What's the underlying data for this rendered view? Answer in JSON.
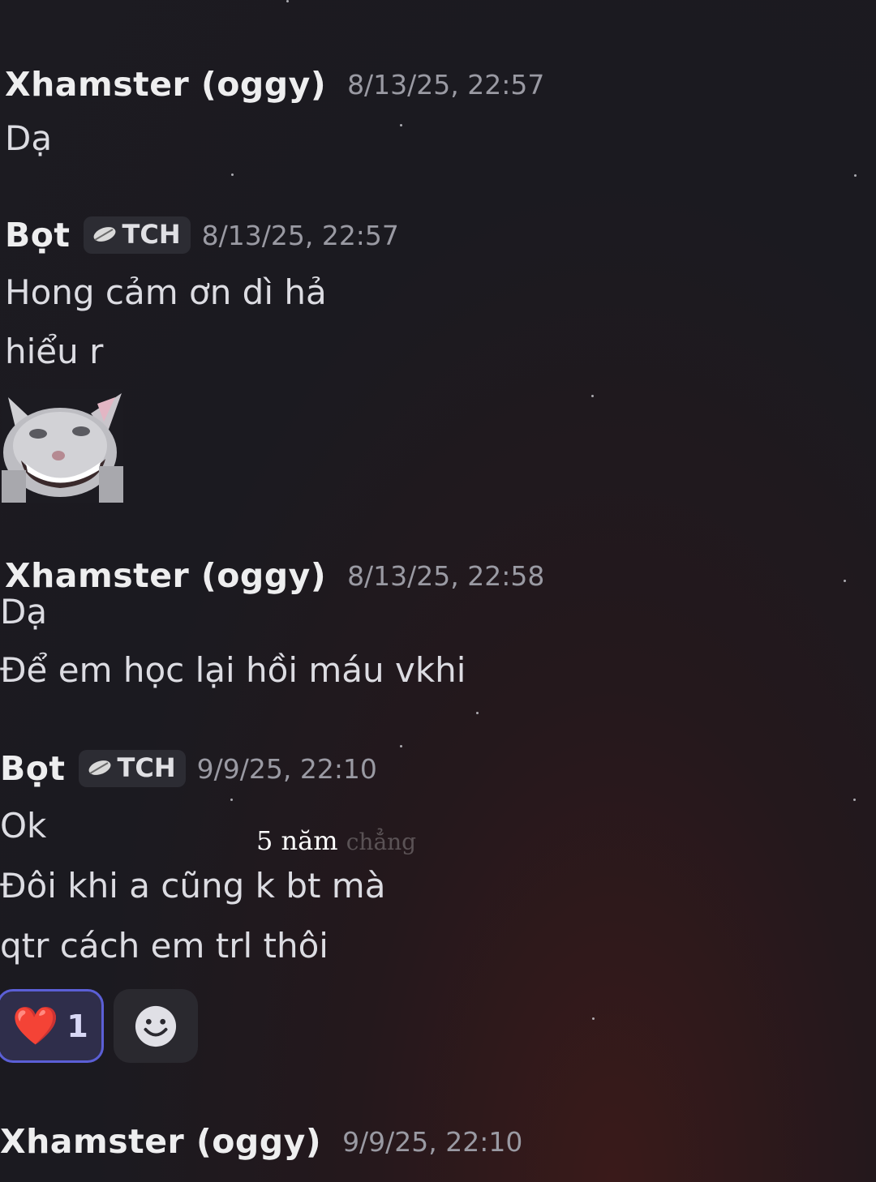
{
  "messages": [
    {
      "username": "Xhamster (oggy)",
      "timestamp": "8/13/25, 22:57",
      "lines": [
        "Dạ"
      ]
    },
    {
      "username": "Bọt",
      "tag": "TCH",
      "timestamp": "8/13/25, 22:57",
      "lines": [
        "Hong cảm ơn dì hả",
        "hiểu r"
      ],
      "sticker": "grinning-cat-sticker"
    },
    {
      "username": "Xhamster (oggy)",
      "timestamp": "8/13/25, 22:58",
      "lines": [
        "Dạ",
        "Để em học lại hồi máu vkhi"
      ]
    },
    {
      "username": "Bọt",
      "tag": "TCH",
      "timestamp": "9/9/25, 22:10",
      "lines": [
        "Ok",
        "Đôi khi a cũng k bt mà",
        "qtr cách em trl thôi"
      ],
      "reactions": [
        {
          "emoji": "❤️",
          "count": "1"
        }
      ],
      "add_reaction_icon": "smiley-add-reaction-icon"
    },
    {
      "username": "Xhamster (oggy)",
      "timestamp": "9/9/25, 22:10"
    }
  ],
  "overlay": {
    "text_main": "5 năm",
    "text_fade": "chẳng"
  },
  "colors": {
    "background": "#1c1b21",
    "reaction_border": "#5b5fd6",
    "timestamp": "#9a9aa3"
  }
}
